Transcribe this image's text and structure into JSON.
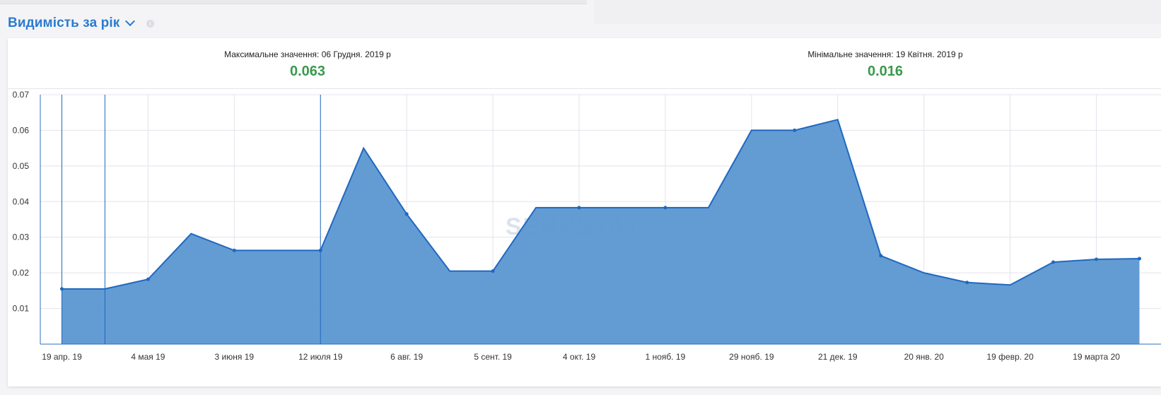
{
  "header": {
    "title": "Видимість за рік"
  },
  "stats": {
    "max_label": "Максимальне значення: 06 Грудня. 2019 р",
    "max_value": "0.063",
    "min_label": "Мінімальне значення: 19 Квітня. 2019 р",
    "min_value": "0.016"
  },
  "watermark": "SERPSTAT",
  "colors": {
    "accent": "#2b7bd1",
    "area_fill": "#5b97d1",
    "area_line": "#1f68c0",
    "value_green": "#3a9a4c"
  },
  "chart_data": {
    "type": "area",
    "x_tick_labels": [
      "19 апр. 19",
      "4 мая 19",
      "3 июня 19",
      "12 июля 19",
      "6 авг. 19",
      "5 сент. 19",
      "4 окт. 19",
      "1 нояб. 19",
      "29 нояб. 19",
      "21 дек. 19",
      "20 янв. 20",
      "19 февр. 20",
      "19 марта 20"
    ],
    "y_ticks": [
      0.01,
      0.02,
      0.03,
      0.04,
      0.05,
      0.06,
      0.07
    ],
    "y_tick_labels": [
      "0.01",
      "0.02",
      "0.03",
      "0.04",
      "0.05",
      "0.06",
      "0.07"
    ],
    "ylim": [
      0,
      0.07
    ],
    "xlim": [
      -0.5,
      25.5
    ],
    "grid": true,
    "x": [
      0,
      1,
      2,
      3,
      4,
      5,
      6,
      7,
      8,
      9,
      10,
      11,
      12,
      13,
      14,
      15,
      16,
      17,
      18,
      19,
      20,
      21,
      22,
      23,
      24,
      25
    ],
    "values": [
      0.0155,
      0.0155,
      0.0182,
      0.031,
      0.0263,
      0.0263,
      0.0263,
      0.055,
      0.0365,
      0.0205,
      0.0205,
      0.0383,
      0.0383,
      0.0383,
      0.0383,
      0.0383,
      0.06,
      0.06,
      0.063,
      0.0248,
      0.02,
      0.0173,
      0.0166,
      0.023,
      0.0238,
      0.024
    ],
    "markers": [
      0,
      2,
      4,
      6,
      8,
      10,
      12,
      14,
      17,
      19,
      21,
      23,
      24,
      25
    ],
    "vertical_lines": [
      0,
      1,
      6
    ]
  }
}
